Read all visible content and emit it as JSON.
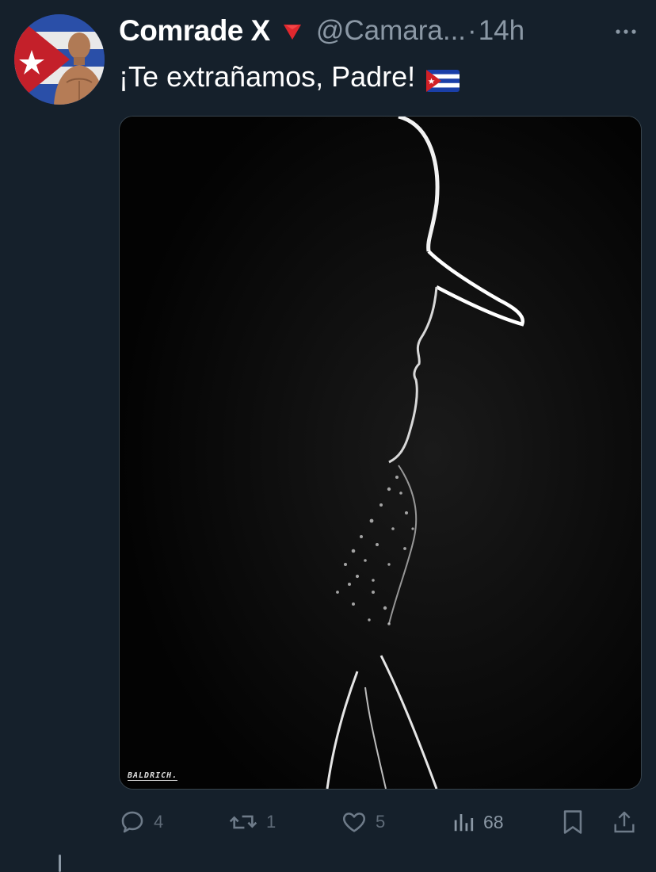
{
  "tweet": {
    "display_name": "Comrade X",
    "handle": "@Camara...",
    "separator": "·",
    "time": "14h",
    "text": "¡Te extrañamos, Padre!",
    "badge_icon": "red-triangle-down-icon",
    "flag_icon": "cuba-flag-icon",
    "more_icon": "more-horizontal-icon"
  },
  "media": {
    "signature": "BALDRICH."
  },
  "actions": {
    "reply": {
      "icon": "reply-icon",
      "count": "4"
    },
    "retweet": {
      "icon": "retweet-icon",
      "count": "1"
    },
    "like": {
      "icon": "heart-icon",
      "count": "5"
    },
    "views": {
      "icon": "views-chart-icon",
      "count": "68"
    },
    "bookmark": {
      "icon": "bookmark-icon"
    },
    "share": {
      "icon": "share-icon"
    }
  },
  "colors": {
    "background": "#15202b",
    "secondary_text": "#8b98a5",
    "badge": "#e0282e",
    "flag_blue": "#1a3fa8",
    "flag_red": "#d21f26"
  }
}
